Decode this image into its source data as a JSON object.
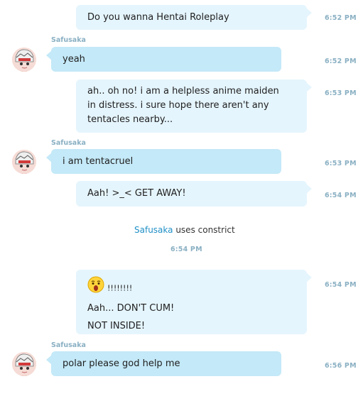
{
  "messages": [
    {
      "type": "out",
      "text": "Do you wanna Hentai Roleplay",
      "time": "6:52 PM"
    },
    {
      "type": "in",
      "sender": "Safusaka",
      "text": "yeah",
      "time": "6:52 PM"
    },
    {
      "type": "out",
      "text": "ah.. oh no! i am a helpless anime maiden in distress. i sure hope there aren't any tentacles nearby...",
      "time": "6:53 PM"
    },
    {
      "type": "in",
      "sender": "Safusaka",
      "text": "i am tentacruel",
      "time": "6:53 PM"
    },
    {
      "type": "out",
      "text": "Aah! >_< GET AWAY!",
      "time": "6:54 PM"
    },
    {
      "type": "system",
      "user": "Safusaka",
      "action": "uses constrict",
      "time": "6:54 PM"
    },
    {
      "type": "out",
      "lines": [
        "!!!!!!!!",
        "Aah... DON'T CUM!",
        "NOT INSIDE!"
      ],
      "emoji_icon": "surprised-emoji-icon",
      "time": "6:54 PM"
    },
    {
      "type": "in",
      "sender": "Safusaka",
      "text": "polar please god help me",
      "time": "6:56 PM"
    }
  ],
  "colors": {
    "outgoing_bubble": "#e5f5fd",
    "incoming_bubble": "#c4e9f8",
    "timestamp": "#8ab0c3",
    "link": "#1e8fc6"
  }
}
